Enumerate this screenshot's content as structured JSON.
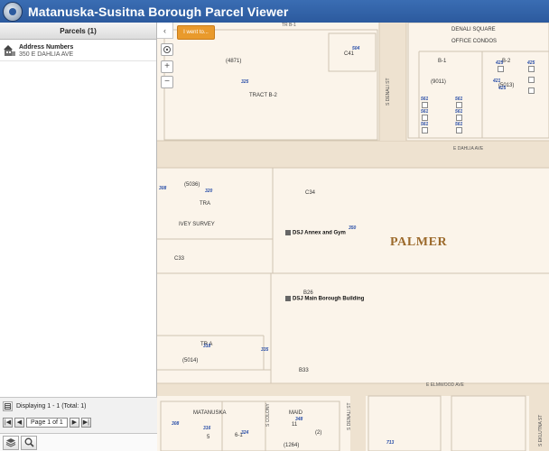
{
  "header": {
    "title": "Matanuska-Susitna Borough Parcel Viewer"
  },
  "panel": {
    "title": "Parcels (1)",
    "result": {
      "title": "Address Numbers",
      "address": "350 E DAHLIA AVE"
    },
    "footer": {
      "status": "Displaying 1 - 1 (Total: 1)",
      "page": "Page 1 of 1"
    },
    "buttons": {
      "first": "|◀",
      "prev": "◀",
      "next": "▶",
      "last": "▶|"
    }
  },
  "map": {
    "iwent_label": "I went to...",
    "collapse_label": "‹",
    "zoom_in": "+",
    "zoom_out": "−",
    "place_label": "PALMER",
    "roads": {
      "dahlia": "E DAHLIA AVE",
      "elmwood": "E ELMWOOD AVE",
      "denali": "S DENALI ST",
      "denali2": "S DENALI ST",
      "colony": "S DENALI ST",
      "gulch": "S COLONY",
      "eklutna": "S EKLUTNA ST"
    },
    "buildings": {
      "annex": "DSJ Annex and Gym",
      "main": "DSJ Main Borough Building"
    },
    "labels": {
      "trb1": "TR B-1",
      "c41": "C41",
      "l4871": "(4871)",
      "tractb2": "TRACT B-2",
      "denali_sq1": "DENALI SQUARE",
      "denali_sq2": "OFFICE CONDOS",
      "b1": "B-1",
      "b2": "B-2",
      "l9011": "(9011)",
      "l5013": "(5013)",
      "l5036": "(5036)",
      "tra": "TRA",
      "ivey": "IVEY SURVEY",
      "c34": "C34",
      "c33": "C33",
      "b26": "B26",
      "tra2": "TR A",
      "l5014": "(5014)",
      "b33": "B33",
      "matanuska": "MATANUSKA",
      "maid": "MAID",
      "n5": "5",
      "n11": "11",
      "n6_1": "6-1",
      "l2": "(2)",
      "l1264": "(1264)"
    },
    "numbers": {
      "n504": "504",
      "n325": "325",
      "n425a": "425",
      "n425b": "425",
      "n425c": "425",
      "n421": "421",
      "n561a": "561",
      "n561b": "561",
      "n561c": "561",
      "n561d": "561",
      "n561e": "561",
      "n561f": "561",
      "n308": "308",
      "n320": "320",
      "n350": "350",
      "n335": "335",
      "n316": "316",
      "n308b": "308",
      "n318": "318",
      "n324": "324",
      "n348": "348",
      "n713": "713"
    }
  }
}
